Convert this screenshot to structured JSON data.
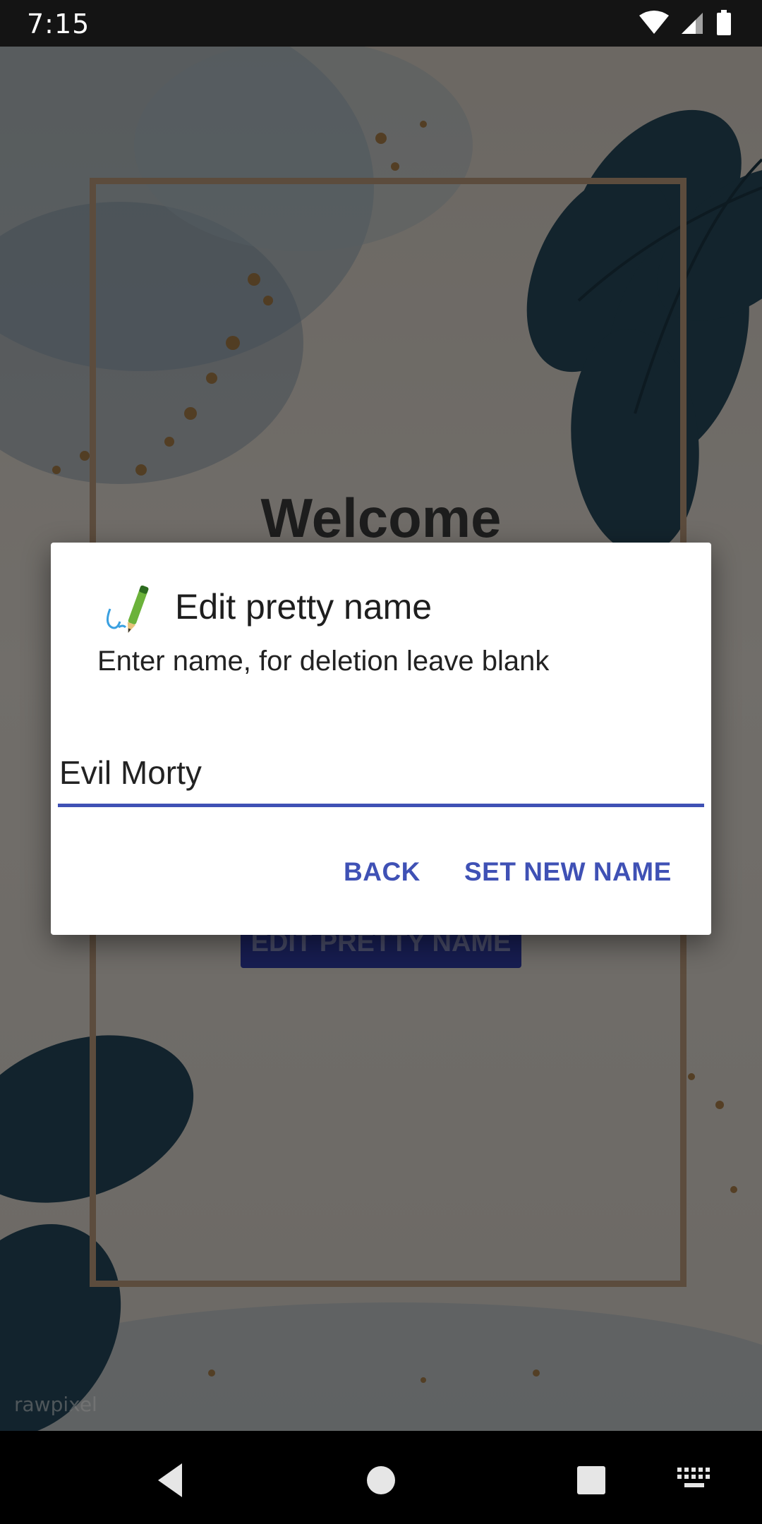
{
  "status_bar": {
    "time": "7:15",
    "icons": [
      "wifi-icon",
      "cell-signal-icon",
      "battery-icon"
    ]
  },
  "background": {
    "welcome_text": "Welcome",
    "edit_button_label": "EDIT PRETTY NAME",
    "watermark": "rawpixel"
  },
  "dialog": {
    "icon": "pen-signature-icon",
    "title": "Edit pretty name",
    "message": "Enter name, for deletion leave blank",
    "input_value": "Evil Morty",
    "back_label": "BACK",
    "set_label": "SET NEW NAME",
    "accent_color": "#3f51b5"
  },
  "nav_bar": {
    "buttons": [
      "back-icon",
      "home-icon",
      "recents-icon",
      "keyboard-icon"
    ]
  }
}
